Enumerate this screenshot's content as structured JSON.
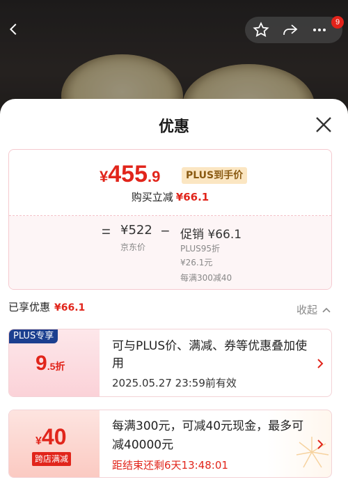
{
  "header": {
    "badge_count": "9",
    "icons": [
      "back-arrow-icon",
      "star-icon",
      "share-icon",
      "more-icon"
    ]
  },
  "sheet": {
    "title": "优惠",
    "price": {
      "symbol": "¥",
      "integer": "455",
      "decimal": ".9",
      "tag": "PLUS到手价"
    },
    "instant_reduction": {
      "label": "购买立减",
      "value": "¥66.1"
    },
    "breakdown": {
      "equals": "=",
      "minus": "−",
      "jd_price": "¥522",
      "jd_label": "京东价",
      "promo_title": "促销 ¥66.1",
      "promo_lines": [
        "PLUS95折",
        "¥26.1元",
        "每满300减40"
      ]
    },
    "enjoyed": {
      "label": "已享优惠",
      "value": "¥66.1"
    },
    "collapse_label": "收起",
    "coupons": [
      {
        "tag": "PLUS专享",
        "discount_big": "9",
        "discount_small": ".5折",
        "desc": "可与PLUS价、满减、券等优惠叠加使用",
        "valid": "2025.05.27 23:59前有效"
      },
      {
        "amount_symbol": "¥",
        "amount": "40",
        "tag": "跨店满减",
        "desc": "每满300元，可减40元现金，最多可减40000元",
        "timer": "距结束还剩6天13:48:01"
      }
    ]
  },
  "colors": {
    "accent": "#e1251b",
    "plus_blue": "#1b3f8f",
    "plus_gold": "#fbe6c2"
  }
}
